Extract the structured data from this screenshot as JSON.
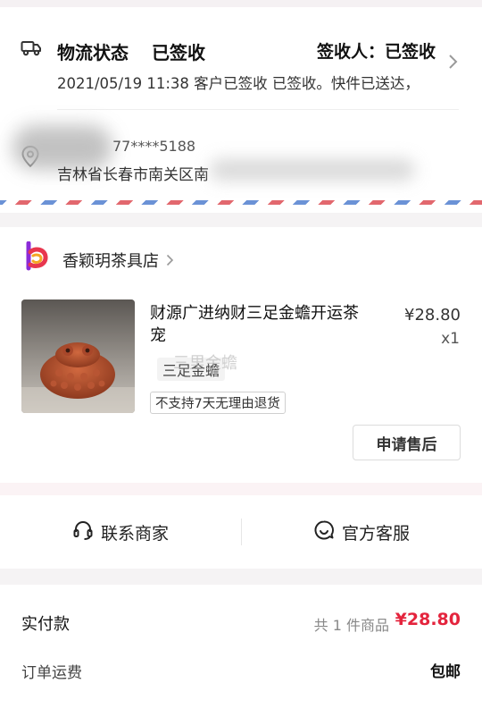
{
  "logistics": {
    "title": "物流状态",
    "status": "已签收",
    "signer": "签收人：已签收",
    "detail": "2021/05/19 11:38 客户已签收 已签收。快件已送达，"
  },
  "address": {
    "phone": "77****5188",
    "address": "吉林省长春市南关区南"
  },
  "shop": {
    "name": "香颖玥茶具店"
  },
  "product": {
    "title": "财源广进纳财三足金蟾开运茶宠",
    "variant": "三足金蟾",
    "tag": "不支持7天无理由退货",
    "price": "¥28.80",
    "quantity": "x1",
    "image_label": "三足金蟾",
    "watermark": "三里金蟾",
    "after_sale_label": "申请售后"
  },
  "contact": {
    "merchant_label": "联系商家",
    "service_label": "官方客服"
  },
  "payment": {
    "paid_label": "实付款",
    "item_count": "共 1 件商品",
    "total": "¥28.80",
    "shipping_label": "订单运费",
    "shipping_value": "包邮"
  },
  "colors": {
    "accent": "#e4243d",
    "background": "#f5f3f4"
  },
  "icons": [
    "truck-icon",
    "chevron-right-icon",
    "location-pin-icon",
    "shop-logo-icon",
    "headset-icon",
    "chat-smile-icon"
  ]
}
